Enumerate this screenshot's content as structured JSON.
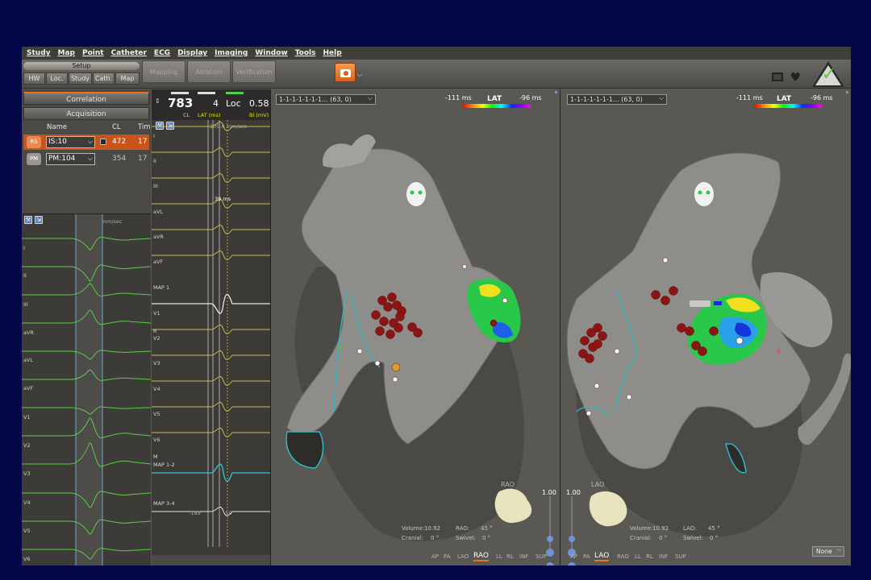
{
  "menu": [
    "Study",
    "Map",
    "Point",
    "Catheter",
    "ECG",
    "Display",
    "Imaging",
    "Window",
    "Tools",
    "Help"
  ],
  "toolbar": {
    "setup_label": "Setup",
    "small_buttons": [
      "HW",
      "Loc.",
      "Study",
      "Cath.",
      "Map"
    ],
    "big_buttons": [
      "Mapping",
      "Ablation",
      "Verification"
    ]
  },
  "left_panel": {
    "tabs": [
      "Correlation",
      "Acquisition"
    ],
    "columns": [
      "Name",
      "CL",
      "Tim"
    ],
    "rows": [
      {
        "icon": "RS",
        "name": "IS:10",
        "cl": "472",
        "time": "17",
        "selected": true
      },
      {
        "icon": "PM",
        "name": "PM:104",
        "cl": "354",
        "time": "17",
        "selected": false
      }
    ],
    "speed": "100.0 mm/sec",
    "leads": [
      "I",
      "II",
      "III",
      "aVR",
      "aVL",
      "aVF",
      "V1",
      "V2",
      "V3",
      "V4",
      "V5",
      "V6"
    ]
  },
  "ep_panel": {
    "cl_value": "783",
    "cl_label": "CL",
    "lat_value": "4",
    "lat_label": "LAT (ms)",
    "loc_label": "Loc",
    "bi_value": "0.58",
    "bi_label": "Bi (mV)",
    "speed": "100.0 mm/sec",
    "interval": "39 ms",
    "leads": [
      "I",
      "II",
      "III",
      "aVL",
      "aVR",
      "aVF",
      "MAP 1",
      "V1",
      "R",
      "V2",
      "V3",
      "V4",
      "V5",
      "V6",
      "M",
      "MAP 1-2",
      "MAP 3-4"
    ],
    "tick_left": "-189",
    "tick_right": "-50"
  },
  "map_rao": {
    "view_select": "1-1-1-1-1-1-1... (63, 0)",
    "lat_title": "LAT",
    "lat_min": "-111 ms",
    "lat_max": "-96 ms",
    "zoom": "1.00",
    "view_name": "RAO",
    "volume_label": "Volume:",
    "volume_value": "10.92",
    "angle_label": "RAO:",
    "angle_value": "45 °",
    "cranial_label": "Cranial:",
    "cranial_value": "0 °",
    "swivel_label": "Swivel:",
    "swivel_value": "0 °",
    "orientations": [
      "AP",
      "PA",
      "LAO",
      "RAO",
      "LL",
      "RL",
      "INF",
      "SUP"
    ],
    "active_orientation": "RAO",
    "mapping_label": "R"
  },
  "map_lao": {
    "view_select": "1-1-1-1-1-1-1... (63, 0)",
    "lat_title": "LAT",
    "lat_min": "-111 ms",
    "lat_max": "-96 ms",
    "zoom": "1.00",
    "view_name": "LAO",
    "volume_label": "Volume:",
    "volume_value": "10.92",
    "angle_label": "LAO:",
    "angle_value": "45 °",
    "cranial_label": "Cranial:",
    "cranial_value": "0 °",
    "swivel_label": "Swivel:",
    "swivel_value": "0 °",
    "orientations": [
      "AP",
      "PA",
      "LAO",
      "RAO",
      "LL",
      "RL",
      "INF",
      "SUP"
    ],
    "active_orientation": "LAO",
    "mapping_label": "R",
    "none_select": "None"
  },
  "colors": {
    "accent": "#f0721a",
    "ecg_green": "#5ec94a",
    "ep_yellow": "#c8c34a",
    "map_cyan": "#2fb8c7"
  }
}
